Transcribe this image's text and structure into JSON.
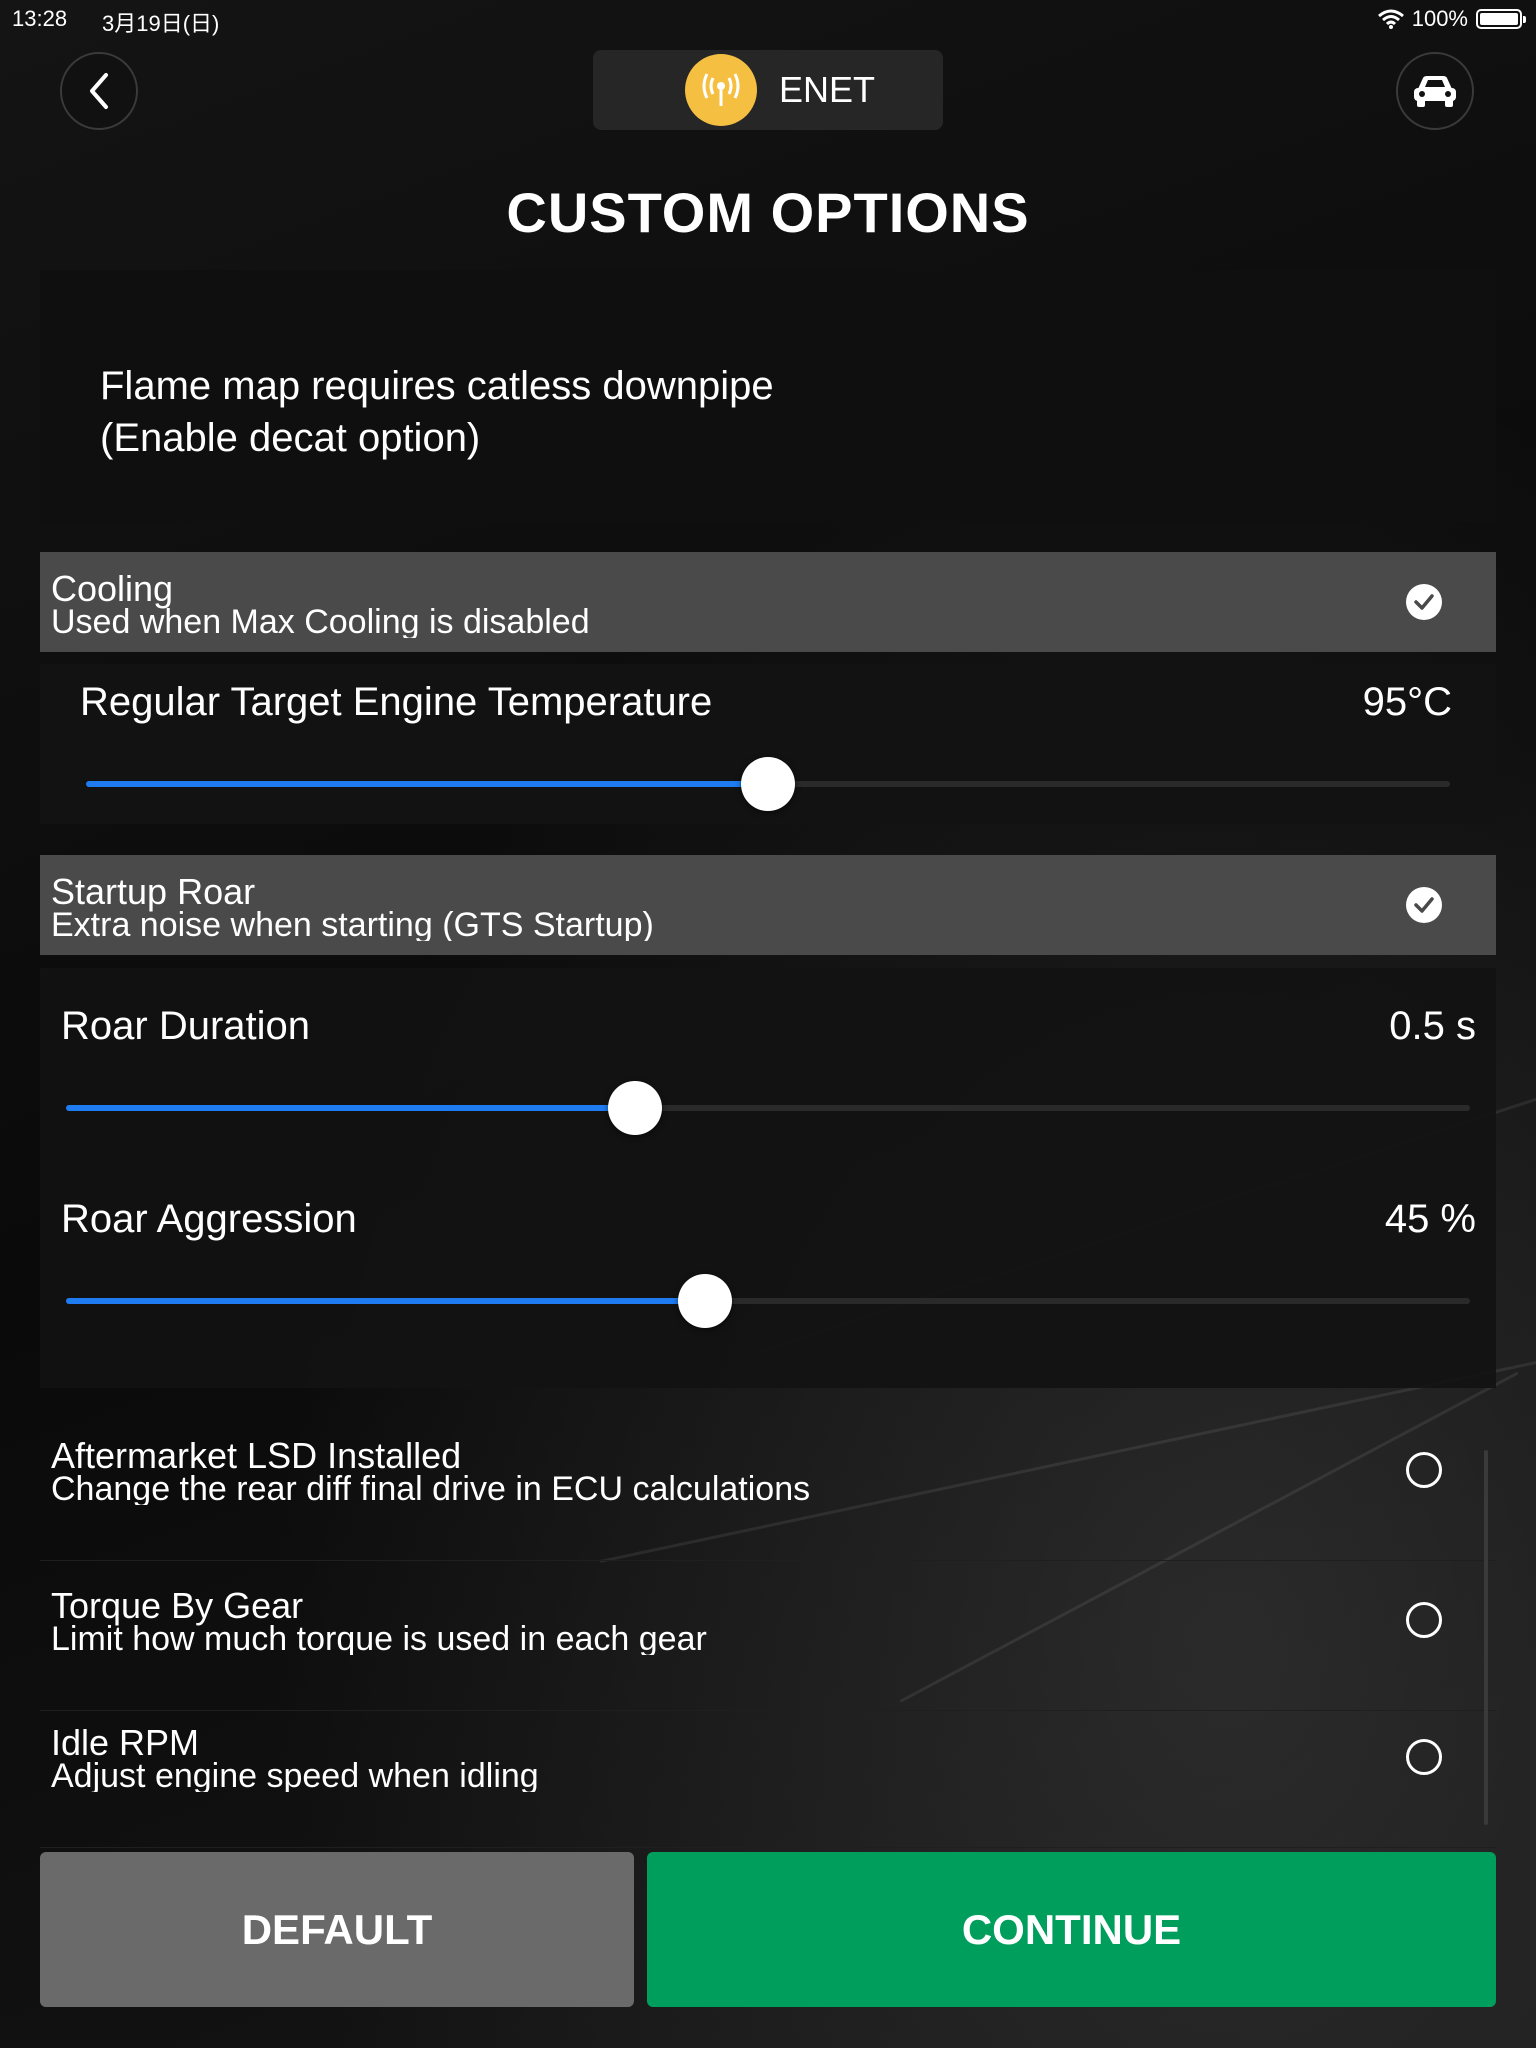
{
  "status_bar": {
    "time": "13:28",
    "date": "3月19日(日)",
    "battery": "100%",
    "battery_level": 1.0
  },
  "header": {
    "connection_label": "ENET",
    "icons": [
      "back-chevron-icon",
      "antenna-icon",
      "car-icon"
    ],
    "accent_color": "#f5c042"
  },
  "page_title": "CUSTOM OPTIONS",
  "note": {
    "line1": "Flame map requires catless downpipe",
    "line2": "(Enable decat option)"
  },
  "sections": {
    "cooling": {
      "title": "Cooling",
      "subtitle": "Used when Max Cooling is disabled",
      "checked": true,
      "slider": {
        "label": "Regular Target Engine Temperature",
        "value": "95°C",
        "fraction": 0.5
      }
    },
    "startup_roar": {
      "title": "Startup Roar",
      "subtitle": "Extra noise when starting (GTS Startup)",
      "checked": true,
      "sliders": [
        {
          "label": "Roar Duration",
          "value": "0.5 s",
          "fraction": 0.405
        },
        {
          "label": "Roar Aggression",
          "value": "45 %",
          "fraction": 0.455
        }
      ]
    }
  },
  "options": [
    {
      "title": "Aftermarket LSD Installed",
      "subtitle": "Change the rear diff final drive in ECU calculations",
      "checked": false
    },
    {
      "title": "Torque By Gear",
      "subtitle": "Limit how much torque is used in each gear",
      "checked": false
    },
    {
      "title": "Idle RPM",
      "subtitle": "Adjust engine speed when idling",
      "checked": false
    }
  ],
  "buttons": {
    "default_label": "DEFAULT",
    "continue_label": "CONTINUE"
  },
  "colors": {
    "slider_fill": "#1e7bf0",
    "continue": "#009e5c",
    "default": "#6a6a6a",
    "section_header": "#4a4a4a"
  }
}
